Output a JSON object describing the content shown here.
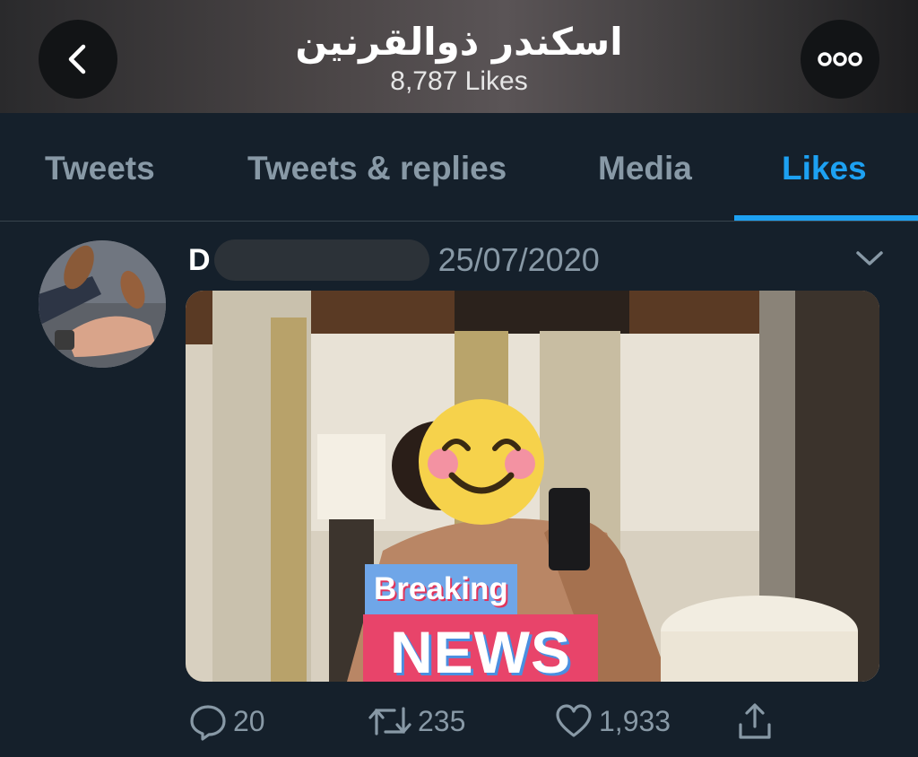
{
  "header": {
    "title": "اسكندر ذوالقرنين",
    "subtitle": "8,787 Likes",
    "back_icon": "chevron-left-icon",
    "more_icon": "more-horizontal-icon"
  },
  "tabs": [
    {
      "label": "Tweets"
    },
    {
      "label": "Tweets & replies"
    },
    {
      "label": "Media"
    },
    {
      "label": "Likes"
    }
  ],
  "active_tab": "Likes",
  "colors": {
    "accent": "#1da1f2",
    "background": "#15202b",
    "muted_text": "#8899a6"
  },
  "tweet": {
    "author_initial": "D",
    "date": "25/07/2020",
    "media": {
      "overlay_sticker_top": "Breaking",
      "overlay_sticker_bottom": "NEWS",
      "face_cover": "smiling-face-emoji"
    },
    "actions": {
      "replies": "20",
      "retweets": "235",
      "likes": "1,933"
    }
  }
}
